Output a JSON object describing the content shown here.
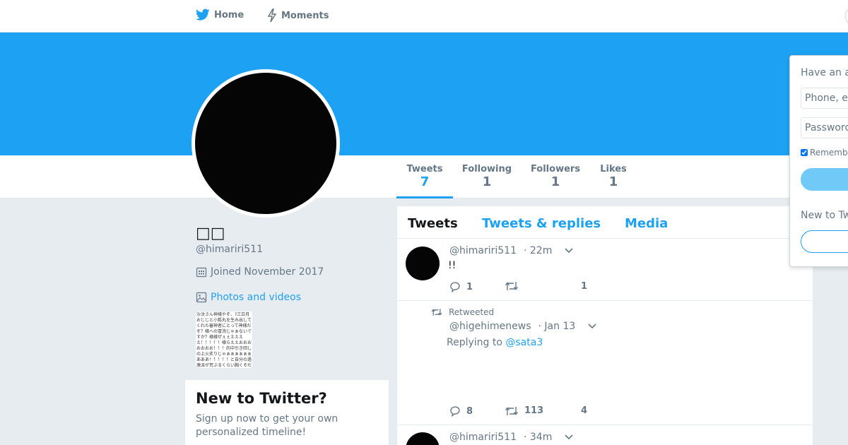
{
  "nav": {
    "home_label": "Home",
    "moments_label": "Moments"
  },
  "profile": {
    "name": "□□",
    "handle": "@himariri511",
    "joined": "Joined November 2017",
    "photos_label": "Photos and videos",
    "thumb_text": "沙汰さん神様やぞ、?三日月おじじと小狐丸を生み出してくれた審神者にとって神様だぞ？様への冒涜じゃぁないですか？様様ぜぇぇええええ！！！！！様らええおおおおおおお！！！的中引き回しの上火炙りじゃぁぁぁぁぁぁあああ！！！！！と自分の過激派が荒ぶるくらい胸くそだわ"
  },
  "stats": {
    "tweets_label": "Tweets",
    "tweets_value": "7",
    "following_label": "Following",
    "following_value": "1",
    "followers_label": "Followers",
    "followers_value": "1",
    "likes_label": "Likes",
    "likes_value": "1"
  },
  "signup_card": {
    "title": "New to Twitter?",
    "subtitle": "Sign up now to get your own personalized timeline!"
  },
  "timeline": {
    "tabs": [
      "Tweets",
      "Tweets & replies",
      "Media"
    ],
    "tweets": [
      {
        "handle": "@himariri511",
        "time": "· 22m",
        "text": "!!",
        "replies": "1",
        "retweets": "",
        "likes": "1"
      },
      {
        "retweet_label": "Retweeted",
        "handle": "@higehimenews",
        "time": "· Jan 13",
        "replying_prefix": "Replying to",
        "replying_to": "@sata3",
        "replies": "8",
        "retweets": "113",
        "likes": "4"
      },
      {
        "handle": "@himariri511",
        "time": "· 34m"
      }
    ]
  },
  "login": {
    "heading": "Have an a",
    "phone_placeholder": "Phone, e",
    "password_placeholder": "Password",
    "remember_label": "Rememb",
    "new_to": "New to Tw"
  },
  "colors": {
    "brand": "#1da1f2",
    "background": "#e6ecf0",
    "text": "#14171a",
    "muted": "#657786"
  }
}
